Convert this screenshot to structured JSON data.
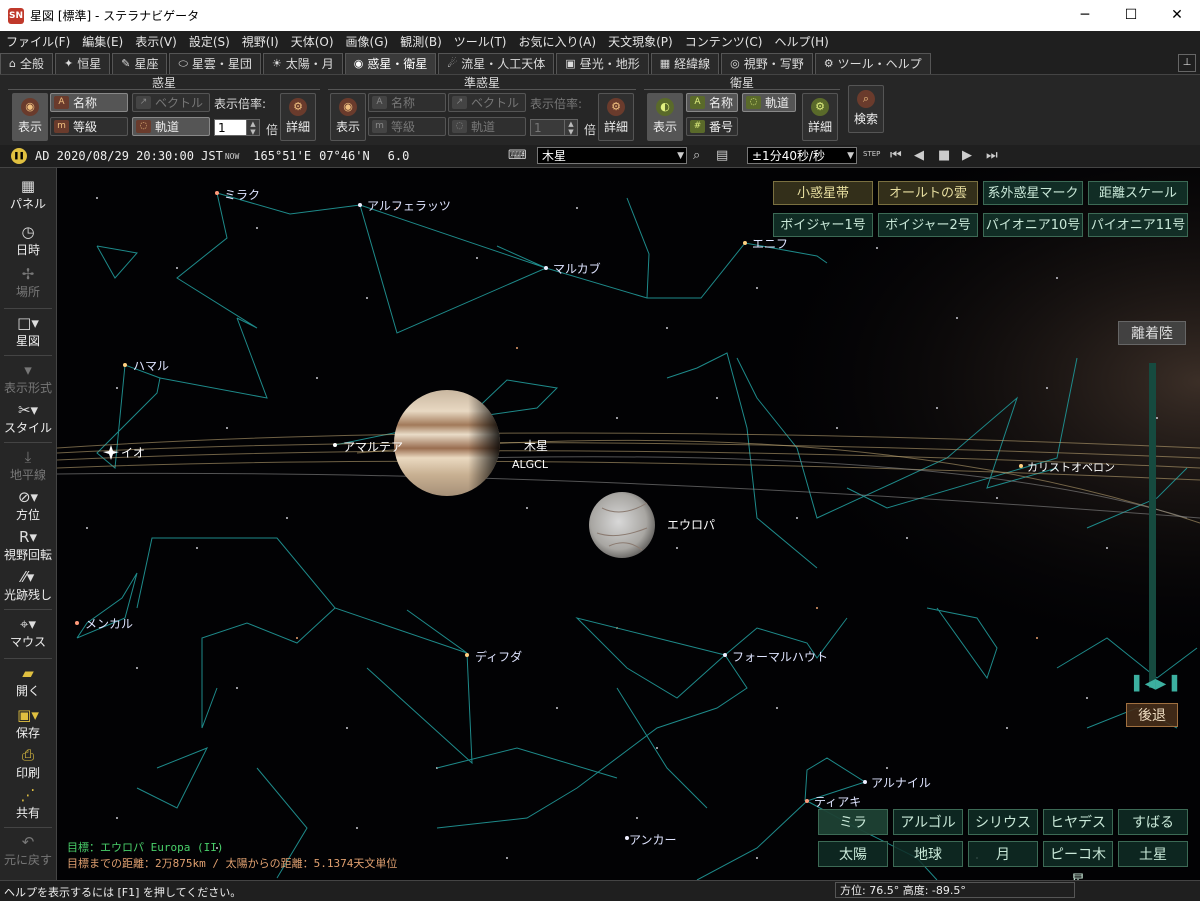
{
  "window": {
    "title": "星図 [標準] - ステラナビゲータ",
    "minimize": "─",
    "maximize": "☐",
    "close": "✕"
  },
  "menu": [
    "ファイル(F)",
    "編集(E)",
    "表示(V)",
    "設定(S)",
    "視野(I)",
    "天体(O)",
    "画像(G)",
    "観測(B)",
    "ツール(T)",
    "お気に入り(A)",
    "天文現象(P)",
    "コンテンツ(C)",
    "ヘルプ(H)"
  ],
  "tabs": [
    "全般",
    "恒星",
    "星座",
    "星雲・星団",
    "太陽・月",
    "惑星・衛星",
    "流星・人工天体",
    "昼光・地形",
    "経緯線",
    "視野・写野",
    "ツール・ヘルプ"
  ],
  "tab_icons": [
    "⌂",
    "✦",
    "✎",
    "⬭",
    "☀",
    "◉",
    "☄",
    "▣",
    "▦",
    "◎",
    "⚙"
  ],
  "ribbon": {
    "planets": {
      "title": "惑星",
      "show": "表示",
      "name": "名称",
      "magnitude": "等級",
      "vector": "ベクトル",
      "orbit": "軌道",
      "scale_label": "表示倍率:",
      "scale_value": "1",
      "scale_unit": "倍",
      "detail": "詳細"
    },
    "minor": {
      "title": "準惑星",
      "show": "表示",
      "name": "名称",
      "magnitude": "等級",
      "vector": "ベクトル",
      "orbit": "軌道",
      "scale_label": "表示倍率:",
      "scale_value": "1",
      "scale_unit": "倍",
      "detail": "詳細"
    },
    "satellites": {
      "title": "衛星",
      "show": "表示",
      "name": "名称",
      "orbit": "軌道",
      "number": "番号",
      "detail": "詳細"
    },
    "search": "検索"
  },
  "status": {
    "date": "AD 2020/08/29 20:30:00 JST",
    "now": "NOW",
    "longitude": "165°51'E",
    "latitude": "07°46'N",
    "magnitude": "6.0",
    "object": "木星",
    "rate": "±1分40秒/秒",
    "step": "STEP"
  },
  "left_panel": [
    "パネル",
    "日時",
    "場所",
    "星図",
    "表示形式",
    "スタイル",
    "地平線",
    "方位",
    "視野回転",
    "光跡残し",
    "マウス",
    "開く",
    "保存",
    "印刷",
    "共有",
    "元に戻す"
  ],
  "sky": {
    "stars": [
      "ミラク",
      "アルフェラッツ",
      "マルカブ",
      "エニフ",
      "ハマル",
      "メンカル",
      "ディフダ",
      "フォーマルハウト",
      "アルナイル",
      "ティアキ",
      "アンカー"
    ],
    "planets": {
      "io": "イオ",
      "amalthea": "アマルテア",
      "jupiter": "木星",
      "adrastea_metis": "ALGCL",
      "europa": "エウロパ",
      "far_moons": "カリストオベロン"
    },
    "top_buttons": [
      "小惑星帯",
      "オールトの雲",
      "系外惑星マーク",
      "距離スケール",
      "ボイジャー1号",
      "ボイジャー2号",
      "パイオニア10号",
      "パイオニア11号"
    ],
    "zoom_top": "離着陸",
    "zoom_bottom": "後退",
    "goto_buttons": [
      "ミラ",
      "アルゴル",
      "シリウス",
      "ヒヤデス",
      "すばる",
      "太陽",
      "地球",
      "月",
      "ピーコ木星",
      "土星"
    ],
    "target_line1": "目標：エウロパ Europa (II)",
    "target_line2": "目標までの距離：2万875km / 太陽からの距離：5.1374天文単位"
  },
  "bottom": {
    "help": "ヘルプを表示するには [F1] を押してください。",
    "altaz": "方位:  76.5° 高度: -89.5°"
  },
  "colors": {
    "constellation_line": "#1e8a8a",
    "star_label": "#dfe4ff",
    "target_green": "#49d06a",
    "target_orange": "#e0a070"
  }
}
